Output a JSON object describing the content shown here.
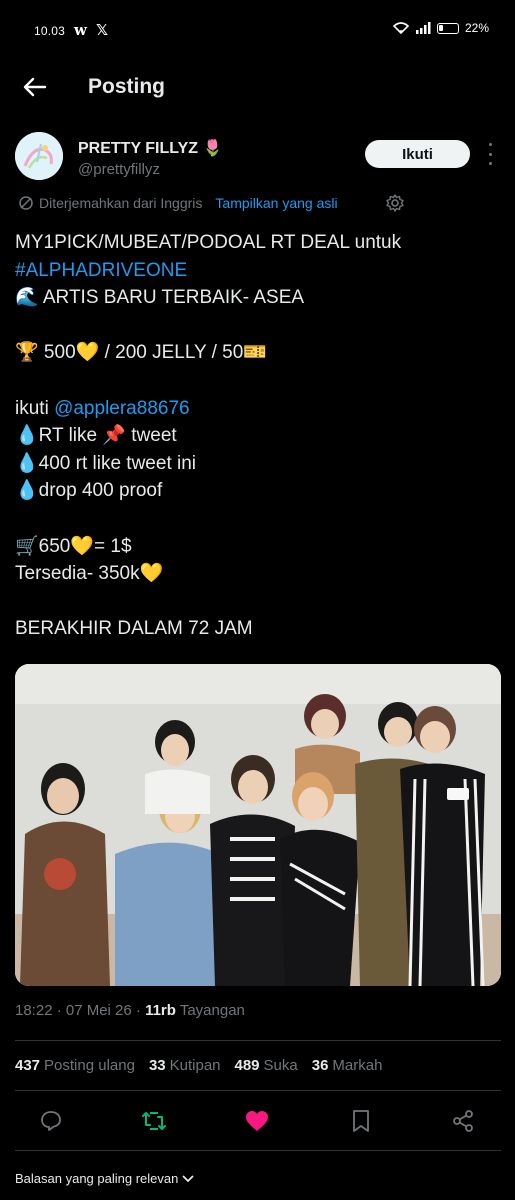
{
  "status_bar": {
    "time": "10.03",
    "app_w": "w",
    "app_x": "𝕏",
    "battery": "22%"
  },
  "header": {
    "title": "Posting"
  },
  "author": {
    "name": "PRETTY FILLYZ 🌷",
    "handle": "@prettyfillyz",
    "follow_label": "Ikuti"
  },
  "translation": {
    "notice": "Diterjemahkan dari Inggris",
    "show_original": "Tampilkan yang asli"
  },
  "tweet": {
    "line1": "MY1PICK/MUBEAT/PODOAL RT DEAL untuk",
    "hashtag": "#ALPHADRIVEONE",
    "line3": "🌊 ARTIS BARU TERBAIK- ASEA",
    "line5": "🏆 500💛 / 200 JELLY / 50🎫",
    "line7_prefix": "ikuti ",
    "mention": "@applera88676",
    "line8": "💧RT like 📌 tweet",
    "line9": "💧400 rt like tweet ini",
    "line10": "💧drop 400 proof",
    "line12": "🛒650💛= 1$",
    "line13": "Tersedia- 350k💛",
    "line15": "BERAKHIR DALAM 72 JAM"
  },
  "meta": {
    "time_date": "18:22 · 07 Mei 26 · ",
    "views_count": "11rb",
    "views_label": " Tayangan"
  },
  "stats": [
    {
      "count": "437",
      "label": "Posting ulang"
    },
    {
      "count": "33",
      "label": "Kutipan"
    },
    {
      "count": "489",
      "label": "Suka"
    },
    {
      "count": "36",
      "label": "Markah"
    }
  ],
  "replies_sort": {
    "label": "Balasan yang paling relevan"
  },
  "colors": {
    "accent": "#1d9bf0",
    "like": "#f91880",
    "repost": "#00ba7c",
    "muted": "#71767b"
  }
}
